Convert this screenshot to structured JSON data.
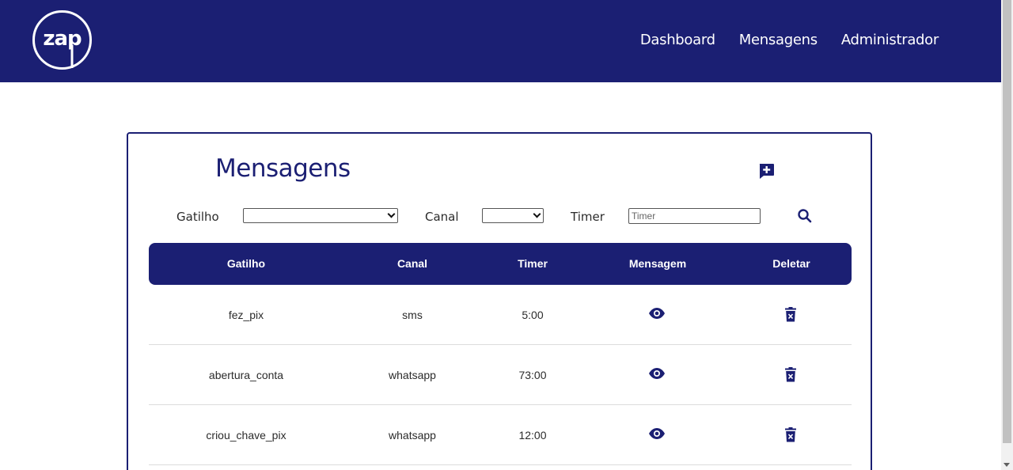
{
  "app": {
    "logo_text": "zap",
    "brand_color": "#1b1f73"
  },
  "nav": {
    "items": [
      {
        "label": "Dashboard"
      },
      {
        "label": "Mensagens"
      },
      {
        "label": "Administrador"
      }
    ]
  },
  "page": {
    "title": "Mensagens",
    "add_icon": "add-message-icon"
  },
  "filters": {
    "gatilho_label": "Gatilho",
    "gatilho_value": "",
    "canal_label": "Canal",
    "canal_value": "",
    "timer_label": "Timer",
    "timer_placeholder": "Timer",
    "timer_value": "",
    "search_icon": "search-icon"
  },
  "table": {
    "headers": [
      "Gatilho",
      "Canal",
      "Timer",
      "Mensagem",
      "Deletar"
    ],
    "rows": [
      {
        "gatilho": "fez_pix",
        "canal": "sms",
        "timer": "5:00"
      },
      {
        "gatilho": "abertura_conta",
        "canal": "whatsapp",
        "timer": "73:00"
      },
      {
        "gatilho": "criou_chave_pix",
        "canal": "whatsapp",
        "timer": "12:00"
      }
    ],
    "view_icon": "eye-icon",
    "delete_icon": "trash-icon"
  }
}
